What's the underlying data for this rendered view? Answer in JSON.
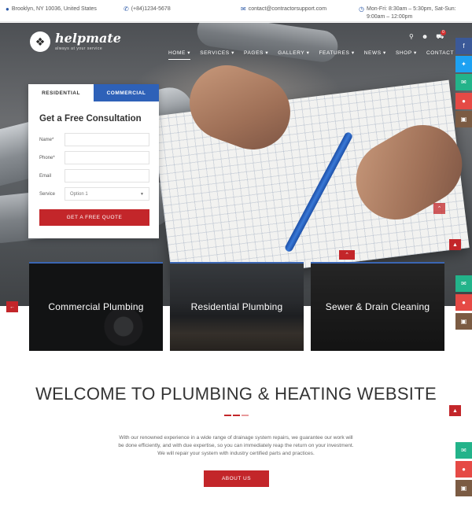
{
  "topbar": {
    "location": "Brooklyn, NY 10036, United States",
    "phone": "(+84)1234-5678",
    "email": "contact@contractorsupport.com",
    "hours_line1": "Mon-Fri: 8:30am – 5:30pm, Sat-Sun:",
    "hours_line2": "9:00am – 12:00pm"
  },
  "brand": {
    "name": "helpmate",
    "tagline": "always at your service"
  },
  "nav": [
    "HOME",
    "SERVICES",
    "PAGES",
    "GALLERY",
    "FEATURES",
    "NEWS",
    "SHOP",
    "CONTACT"
  ],
  "header": {
    "cart_count": "0"
  },
  "form": {
    "tab_residential": "RESIDENTIAL",
    "tab_commercial": "COMMERCIAL",
    "title": "Get a Free Consultation",
    "name_label": "Name*",
    "phone_label": "Phone*",
    "email_label": "Email",
    "service_label": "Service",
    "service_value": "Option 1",
    "submit": "GET A FREE QUOTE"
  },
  "services": [
    "Commercial Plumbing",
    "Residential Plumbing",
    "Sewer & Drain Cleaning"
  ],
  "welcome": {
    "title": "WELCOME TO PLUMBING & HEATING WEBSITE",
    "line1": "With our renowned experience in a wide range of drainage system repairs, we guarantee our work will",
    "line2": "be done efficiently, and with due expertise, so you can immediately reap the return on your investment.",
    "line3": "We will repair your system with industry certified parts and practices.",
    "button": "ABOUT US"
  },
  "colors": {
    "accent_red": "#c3262a",
    "accent_blue": "#2e61b8"
  }
}
